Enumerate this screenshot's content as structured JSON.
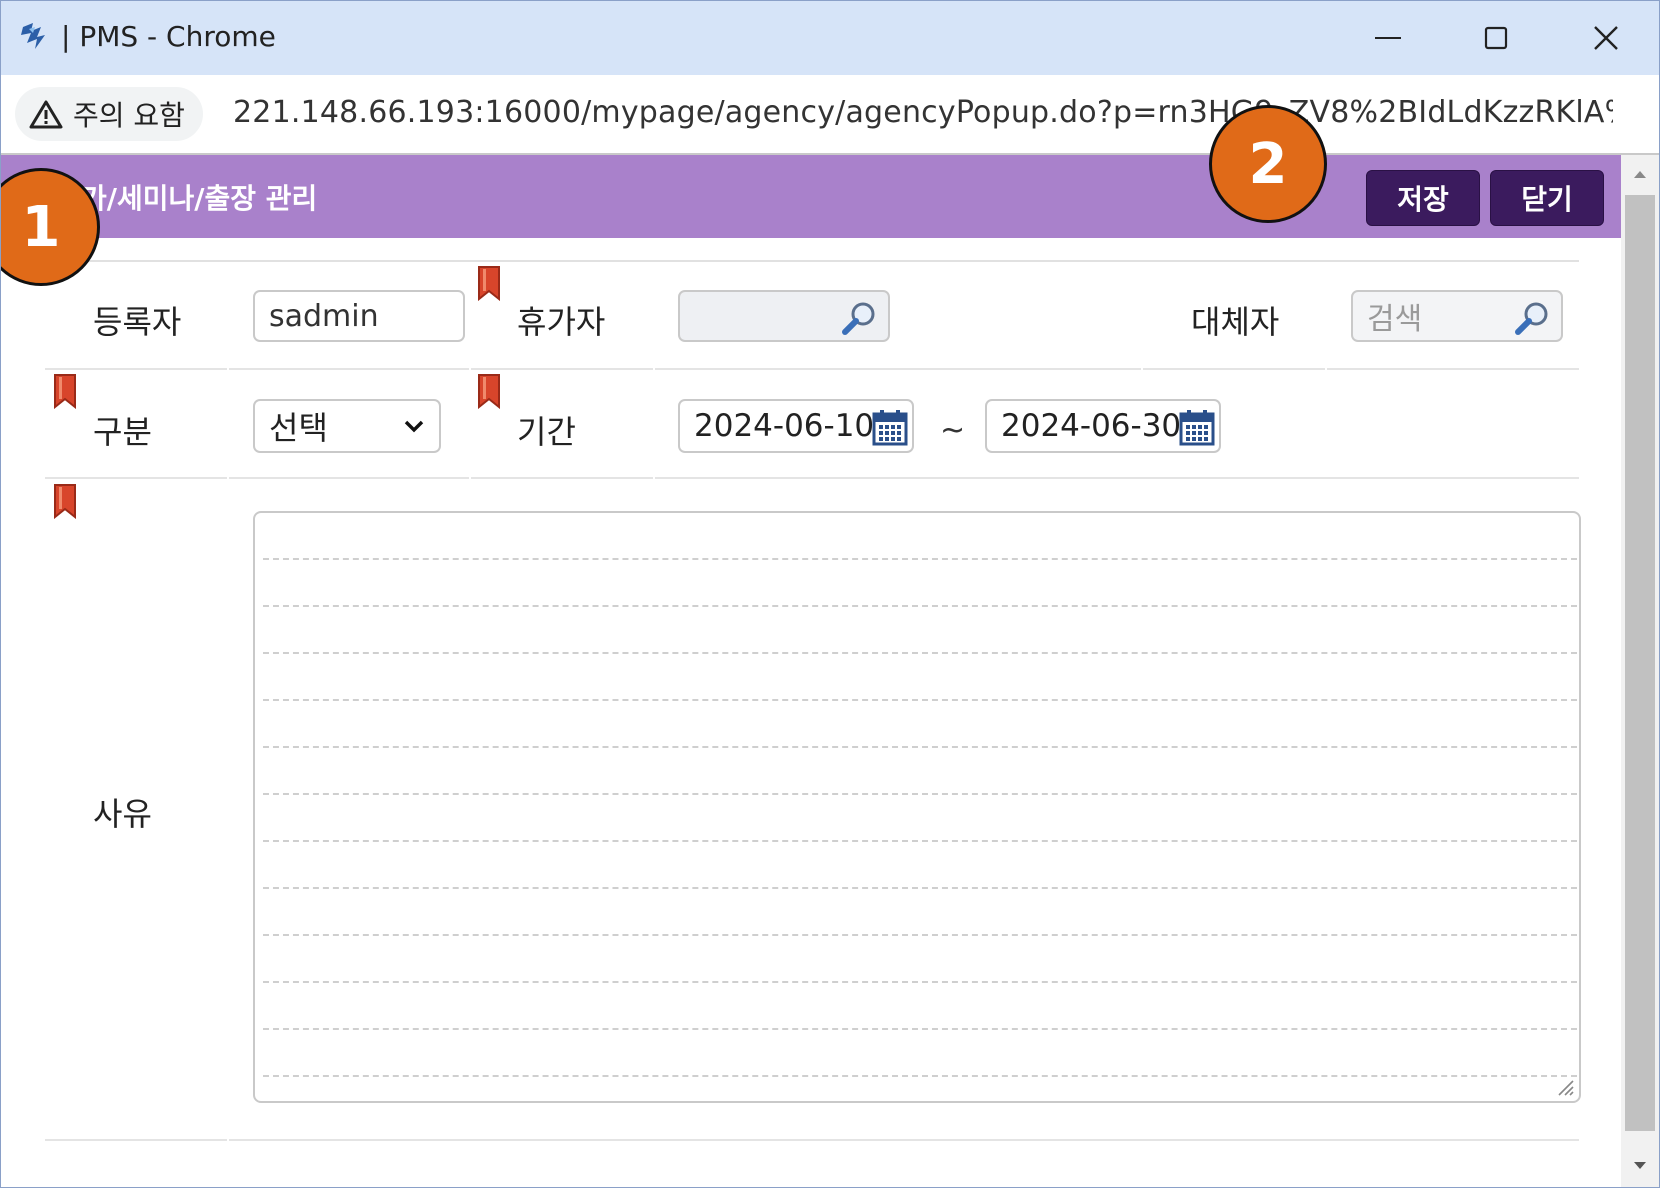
{
  "window": {
    "title": "| PMS - Chrome",
    "app_icon": "pms-logo-icon"
  },
  "addressbar": {
    "security_label": "주의 요함",
    "url": "221.148.66.193:16000/mypage/agency/agencyPopup.do?p=rn3HG9_ZV8%2BIdLdKzzRKlA%..."
  },
  "header": {
    "title": "가/세미나/출장 관리",
    "save_label": "저장",
    "close_label": "닫기",
    "background": "#a981cb",
    "button_color": "#3b1b5e"
  },
  "callouts": {
    "one": "1",
    "two": "2"
  },
  "form": {
    "registrant_label": "등록자",
    "registrant_value": "sadmin",
    "vacationer_label": "휴가자",
    "vacationer_value": "",
    "substitute_label": "대체자",
    "substitute_placeholder": "검색",
    "category_label": "구분",
    "category_value": "선택",
    "period_label": "기간",
    "period_start": "2024-06-10",
    "period_separator": "~",
    "period_end": "2024-06-30",
    "reason_label": "사유",
    "reason_value": ""
  },
  "colors": {
    "callout": "#e06a18",
    "required_marker": "#d8452b"
  }
}
